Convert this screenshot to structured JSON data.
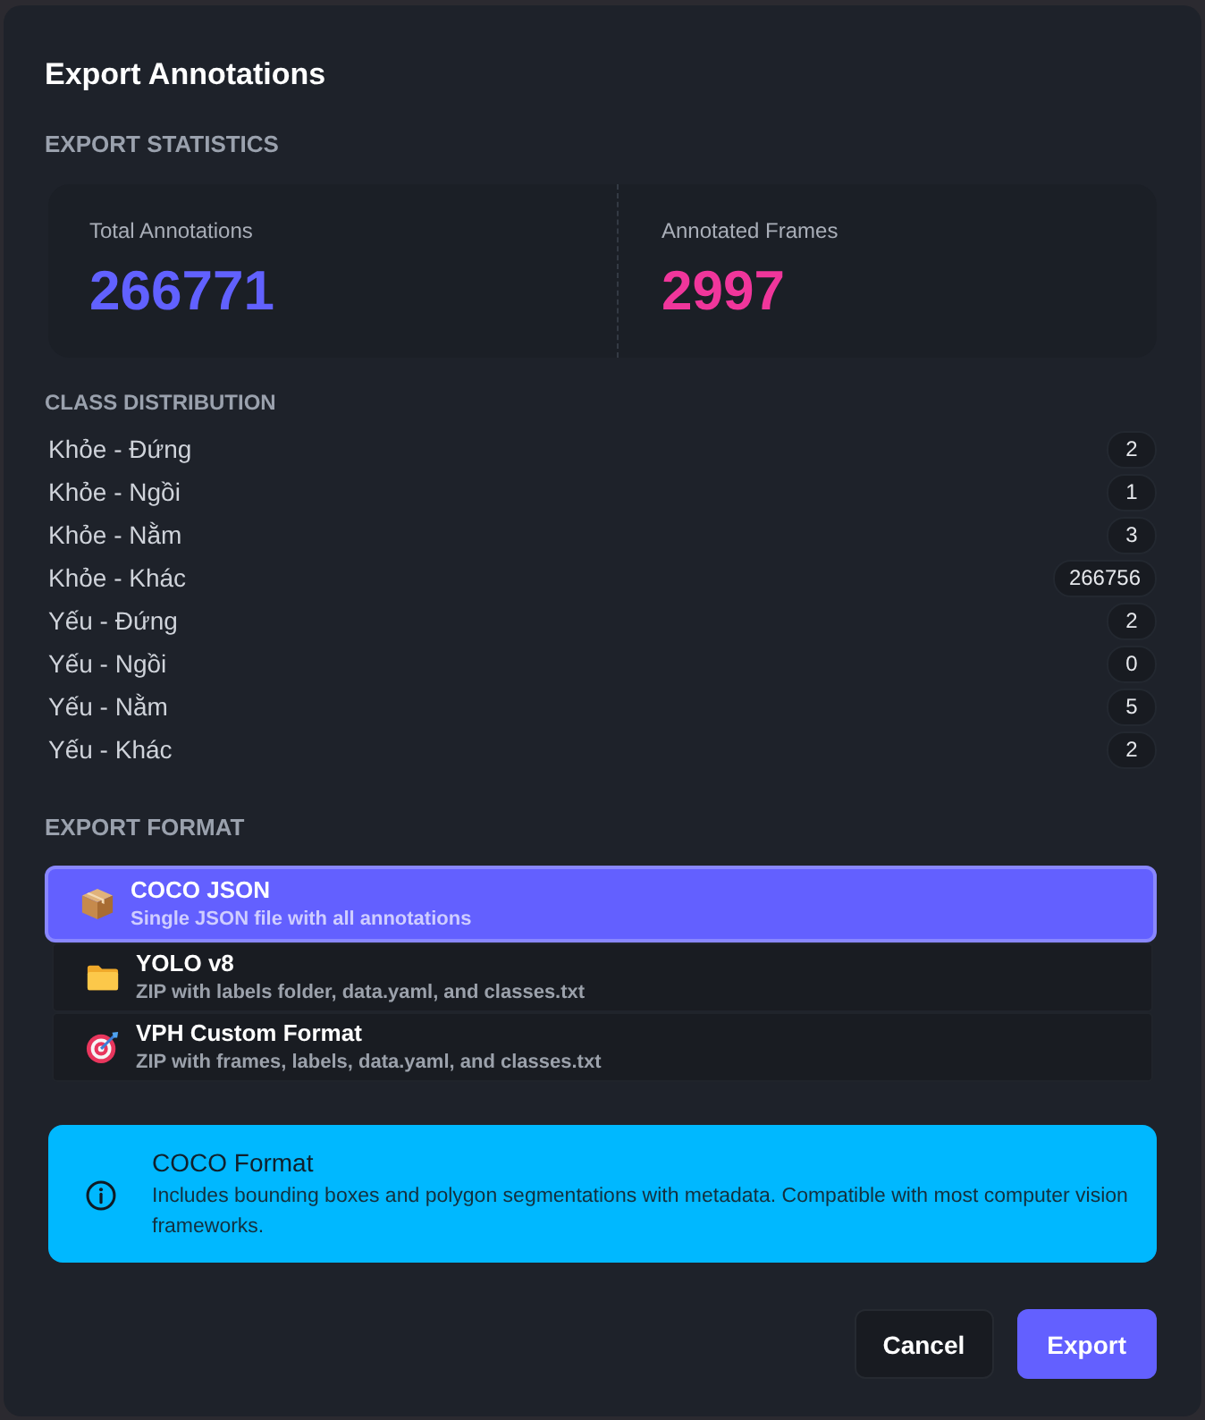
{
  "dialog": {
    "title": "Export Annotations"
  },
  "statistics": {
    "heading": "EXPORT STATISTICS",
    "cards": [
      {
        "label": "Total Annotations",
        "value": "266771",
        "color": "#6161ff"
      },
      {
        "label": "Annotated Frames",
        "value": "2997",
        "color": "#f0369b"
      }
    ]
  },
  "class_distribution": {
    "heading": "CLASS DISTRIBUTION",
    "rows": [
      {
        "name": "Khỏe - Đứng",
        "count": "2"
      },
      {
        "name": "Khỏe - Ngồi",
        "count": "1"
      },
      {
        "name": "Khỏe - Nằm",
        "count": "3"
      },
      {
        "name": "Khỏe - Khác",
        "count": "266756"
      },
      {
        "name": "Yếu - Đứng",
        "count": "2"
      },
      {
        "name": "Yếu - Ngồi",
        "count": "0"
      },
      {
        "name": "Yếu - Nằm",
        "count": "5"
      },
      {
        "name": "Yếu - Khác",
        "count": "2"
      }
    ]
  },
  "export_format": {
    "heading": "EXPORT FORMAT",
    "options": [
      {
        "kind": "package",
        "name": "COCO JSON",
        "description": "Single JSON file with all annotations",
        "selected": true
      },
      {
        "kind": "folder",
        "name": "YOLO v8",
        "description": "ZIP with labels folder, data.yaml, and classes.txt",
        "selected": false
      },
      {
        "kind": "target",
        "name": "VPH Custom Format",
        "description": "ZIP with frames, labels, data.yaml, and classes.txt",
        "selected": false
      }
    ]
  },
  "info": {
    "title": "COCO Format",
    "text": "Includes bounding boxes and polygon segmentations with metadata. Compatible with most computer vision frameworks."
  },
  "buttons": [
    {
      "kind": "secondary",
      "label": "Cancel"
    },
    {
      "kind": "primary",
      "label": "Export"
    }
  ]
}
